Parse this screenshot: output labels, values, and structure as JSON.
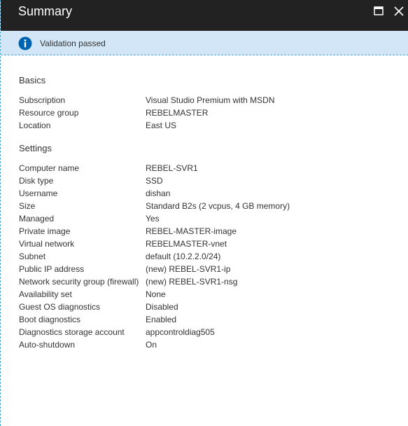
{
  "window": {
    "title": "Summary"
  },
  "banner": {
    "text": "Validation passed",
    "icon": "info-icon",
    "color": "#0063b1"
  },
  "basics": {
    "heading": "Basics",
    "rows": [
      {
        "label": "Subscription",
        "value": "Visual Studio Premium with MSDN"
      },
      {
        "label": "Resource group",
        "value": "REBELMASTER"
      },
      {
        "label": "Location",
        "value": "East US"
      }
    ]
  },
  "settings": {
    "heading": "Settings",
    "rows": [
      {
        "label": "Computer name",
        "value": "REBEL-SVR1"
      },
      {
        "label": "Disk type",
        "value": "SSD"
      },
      {
        "label": "Username",
        "value": "dishan"
      },
      {
        "label": "Size",
        "value": "Standard B2s (2 vcpus, 4 GB memory)"
      },
      {
        "label": "Managed",
        "value": "Yes"
      },
      {
        "label": "Private image",
        "value": "REBEL-MASTER-image"
      },
      {
        "label": "Virtual network",
        "value": "REBELMASTER-vnet"
      },
      {
        "label": "Subnet",
        "value": "default (10.2.2.0/24)"
      },
      {
        "label": "Public IP address",
        "value": "(new) REBEL-SVR1-ip"
      },
      {
        "label": "Network security group (firewall)",
        "value": "(new) REBEL-SVR1-nsg"
      },
      {
        "label": "Availability set",
        "value": "None"
      },
      {
        "label": "Guest OS diagnostics",
        "value": "Disabled"
      },
      {
        "label": "Boot diagnostics",
        "value": "Enabled"
      },
      {
        "label": "Diagnostics storage account",
        "value": "appcontroldiag505"
      },
      {
        "label": "Auto-shutdown",
        "value": "On"
      }
    ]
  }
}
